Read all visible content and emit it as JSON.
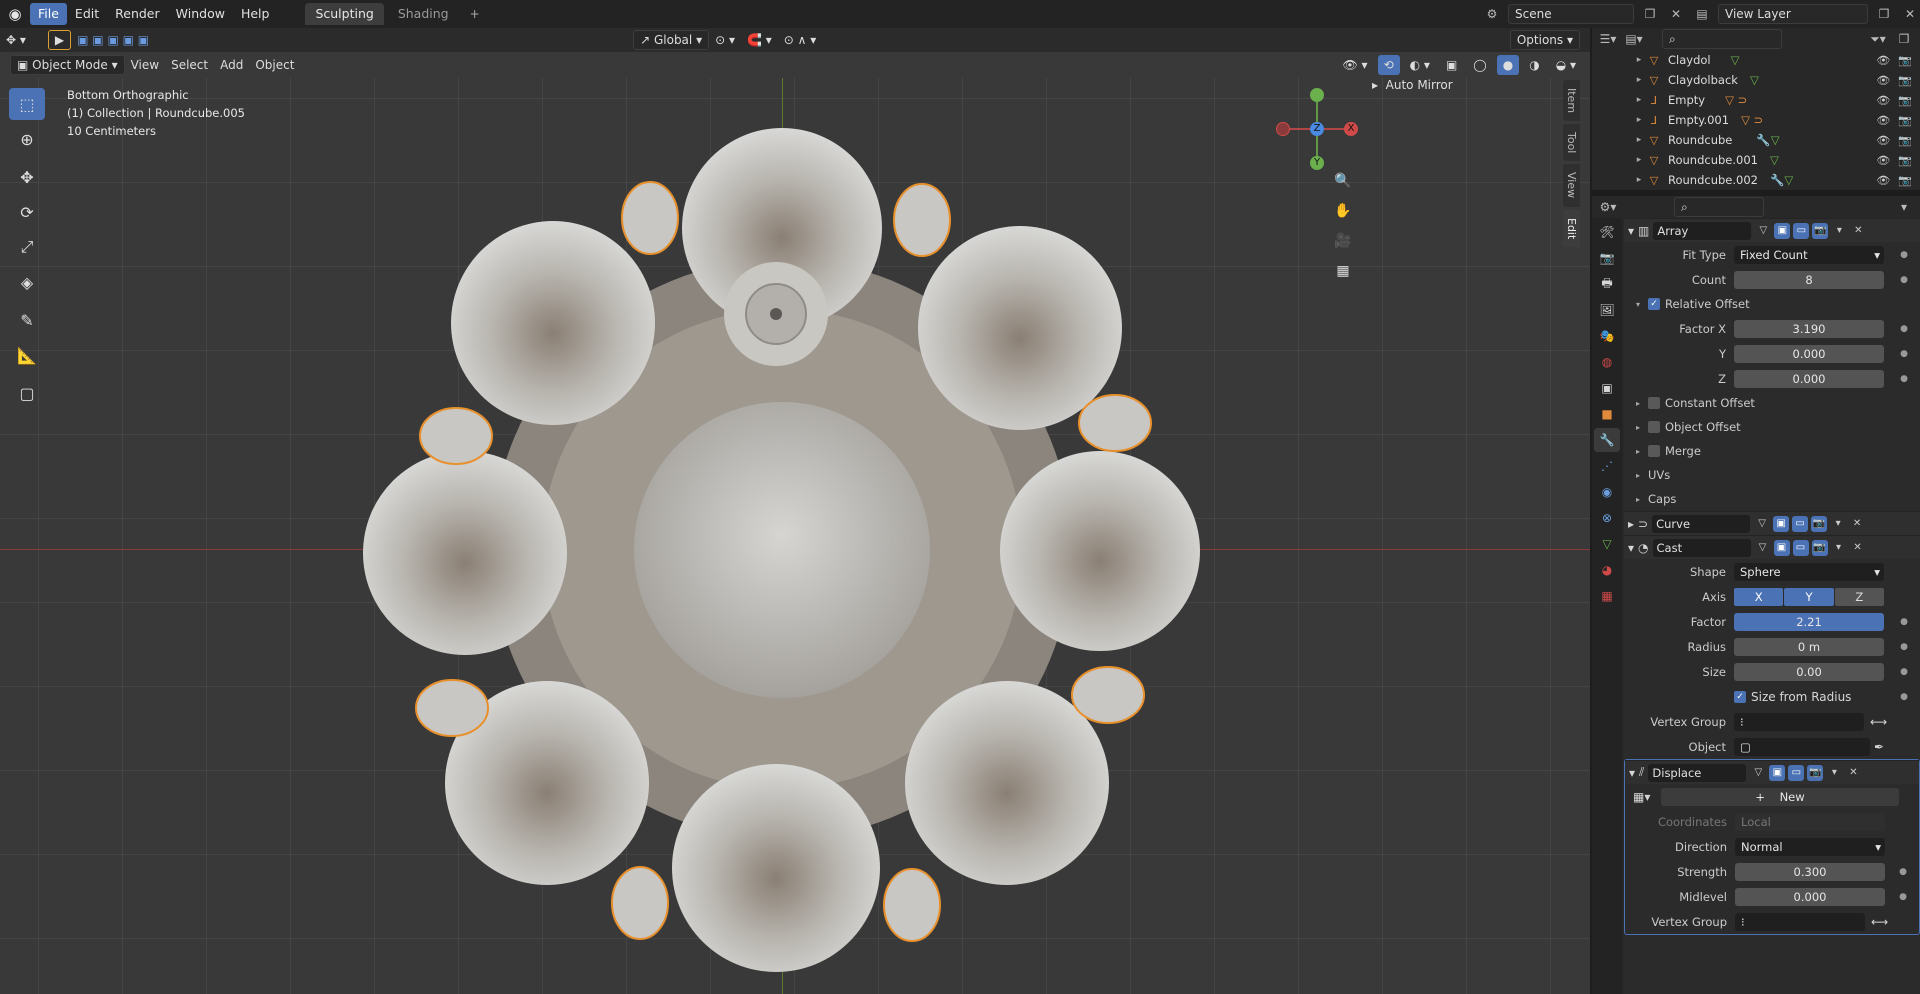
{
  "menu": {
    "items": [
      "File",
      "Edit",
      "Render",
      "Window",
      "Help"
    ],
    "workspaces": [
      "Sculpting",
      "Shading"
    ],
    "add_tab": "+"
  },
  "top_right": {
    "scene": "Scene",
    "view_layer": "View Layer"
  },
  "viewport": {
    "transform": "Global",
    "options": "Options",
    "mode": "Object Mode",
    "menus": [
      "View",
      "Select",
      "Add",
      "Object"
    ],
    "info": [
      "Bottom Orthographic",
      "(1) Collection | Roundcube.005",
      "10 Centimeters"
    ],
    "auto_mirror": "Auto Mirror",
    "npanel_tabs": [
      "Item",
      "Tool",
      "View",
      "Edit"
    ],
    "gizmo": {
      "x": "X",
      "y": "Y",
      "z": "Z"
    }
  },
  "outliner": {
    "rows": [
      {
        "name": "Claydol"
      },
      {
        "name": "Claydolback"
      },
      {
        "name": "Empty"
      },
      {
        "name": "Empty.001"
      },
      {
        "name": "Roundcube"
      },
      {
        "name": "Roundcube.001"
      },
      {
        "name": "Roundcube.002"
      }
    ]
  },
  "modifiers": {
    "array": {
      "name": "Array",
      "fit_type_label": "Fit Type",
      "fit_type": "Fixed Count",
      "count_label": "Count",
      "count": "8",
      "relative_offset": "Relative Offset",
      "factor_x_label": "Factor X",
      "factor_x": "3.190",
      "y_label": "Y",
      "y": "0.000",
      "z_label": "Z",
      "z": "0.000",
      "subs": [
        "Constant Offset",
        "Object Offset",
        "Merge",
        "UVs",
        "Caps"
      ]
    },
    "curve": {
      "name": "Curve"
    },
    "cast": {
      "name": "Cast",
      "shape_label": "Shape",
      "shape": "Sphere",
      "axis_label": "Axis",
      "axes": [
        "X",
        "Y",
        "Z"
      ],
      "factor_label": "Factor",
      "factor": "2.21",
      "radius_label": "Radius",
      "radius": "0 m",
      "size_label": "Size",
      "size": "0.00",
      "size_from_radius": "Size from Radius",
      "vertex_group_label": "Vertex Group",
      "object_label": "Object"
    },
    "displace": {
      "name": "Displace",
      "new_label": "New",
      "coordinates_label": "Coordinates",
      "coordinates": "Local",
      "direction_label": "Direction",
      "direction": "Normal",
      "strength_label": "Strength",
      "strength": "0.300",
      "midlevel_label": "Midlevel",
      "midlevel": "0.000",
      "vertex_group_label": "Vertex Group"
    }
  }
}
